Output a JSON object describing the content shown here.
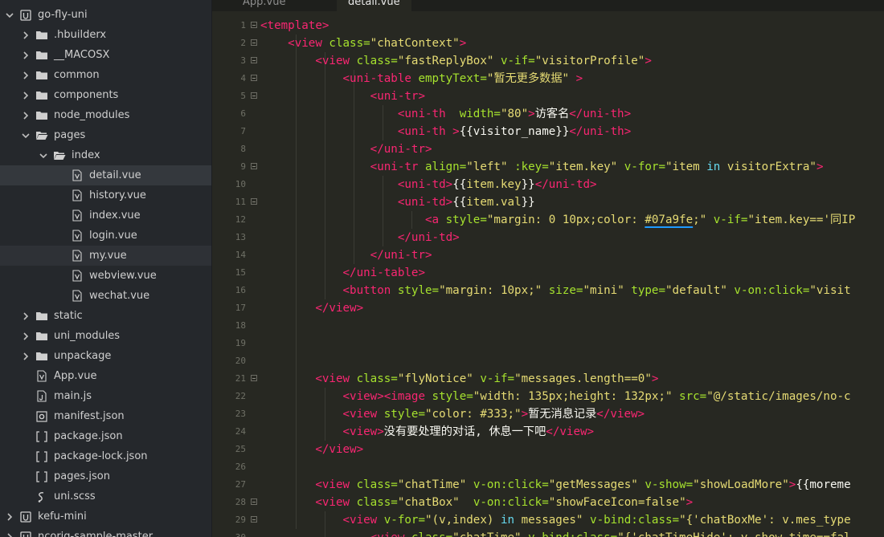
{
  "explorer": {
    "items": [
      {
        "label": "go-fly-uni",
        "depth": 0,
        "kind": "project",
        "expanded": true
      },
      {
        "label": ".hbuilderx",
        "depth": 1,
        "kind": "folder",
        "expanded": false
      },
      {
        "label": "__MACOSX",
        "depth": 1,
        "kind": "folder",
        "expanded": false
      },
      {
        "label": "common",
        "depth": 1,
        "kind": "folder",
        "expanded": false
      },
      {
        "label": "components",
        "depth": 1,
        "kind": "folder",
        "expanded": false
      },
      {
        "label": "node_modules",
        "depth": 1,
        "kind": "folder",
        "expanded": false
      },
      {
        "label": "pages",
        "depth": 1,
        "kind": "folder-open",
        "expanded": true
      },
      {
        "label": "index",
        "depth": 2,
        "kind": "folder-open",
        "expanded": true
      },
      {
        "label": "detail.vue",
        "depth": 3,
        "kind": "vue",
        "selected": true
      },
      {
        "label": "history.vue",
        "depth": 3,
        "kind": "vue"
      },
      {
        "label": "index.vue",
        "depth": 3,
        "kind": "vue"
      },
      {
        "label": "login.vue",
        "depth": 3,
        "kind": "vue"
      },
      {
        "label": "my.vue",
        "depth": 3,
        "kind": "vue",
        "hover": true
      },
      {
        "label": "webview.vue",
        "depth": 3,
        "kind": "vue"
      },
      {
        "label": "wechat.vue",
        "depth": 3,
        "kind": "vue"
      },
      {
        "label": "static",
        "depth": 1,
        "kind": "folder",
        "expanded": false
      },
      {
        "label": "uni_modules",
        "depth": 1,
        "kind": "folder",
        "expanded": false
      },
      {
        "label": "unpackage",
        "depth": 1,
        "kind": "folder",
        "expanded": false
      },
      {
        "label": "App.vue",
        "depth": 1,
        "kind": "vue"
      },
      {
        "label": "main.js",
        "depth": 1,
        "kind": "js"
      },
      {
        "label": "manifest.json",
        "depth": 1,
        "kind": "manifest"
      },
      {
        "label": "package.json",
        "depth": 1,
        "kind": "json"
      },
      {
        "label": "package-lock.json",
        "depth": 1,
        "kind": "json"
      },
      {
        "label": "pages.json",
        "depth": 1,
        "kind": "json"
      },
      {
        "label": "uni.scss",
        "depth": 1,
        "kind": "scss"
      },
      {
        "label": "kefu-mini",
        "depth": 0,
        "kind": "project",
        "expanded": false
      },
      {
        "label": "ncorig-sample-master",
        "depth": 0,
        "kind": "project",
        "expanded": false
      }
    ]
  },
  "tabs": [
    {
      "label": "App.vue",
      "active": false
    },
    {
      "label": "detail.vue",
      "active": true
    }
  ],
  "editor": {
    "lines": [
      {
        "n": "1",
        "fold": true,
        "tokens": [
          [
            "t",
            "<template>"
          ]
        ]
      },
      {
        "n": "2",
        "fold": true,
        "tokens": [
          [
            "p",
            "    "
          ],
          [
            "t",
            "<view "
          ],
          [
            "a",
            "class="
          ],
          [
            "s",
            "\"chatContext\""
          ],
          [
            "t",
            ">"
          ]
        ]
      },
      {
        "n": "3",
        "fold": true,
        "tokens": [
          [
            "p",
            "        "
          ],
          [
            "t",
            "<view "
          ],
          [
            "a",
            "class="
          ],
          [
            "s",
            "\"fastReplyBox\" "
          ],
          [
            "a",
            "v-if="
          ],
          [
            "s",
            "\"visitorProfile\""
          ],
          [
            "t",
            ">"
          ]
        ]
      },
      {
        "n": "4",
        "fold": true,
        "tokens": [
          [
            "p",
            "            "
          ],
          [
            "t",
            "<uni-table "
          ],
          [
            "a",
            "emptyText="
          ],
          [
            "s",
            "\"暂无更多数据\" "
          ],
          [
            "t",
            ">"
          ]
        ]
      },
      {
        "n": "5",
        "fold": true,
        "tokens": [
          [
            "p",
            "                "
          ],
          [
            "t",
            "<uni-tr>"
          ]
        ]
      },
      {
        "n": "6",
        "fold": false,
        "tokens": [
          [
            "p",
            "                    "
          ],
          [
            "t",
            "<uni-th  "
          ],
          [
            "a",
            "width="
          ],
          [
            "s",
            "\"80\""
          ],
          [
            "t",
            ">"
          ],
          [
            "p",
            "访客名"
          ],
          [
            "t",
            "</uni-th>"
          ]
        ]
      },
      {
        "n": "7",
        "fold": false,
        "tokens": [
          [
            "p",
            "                    "
          ],
          [
            "t",
            "<uni-th >"
          ],
          [
            "p",
            "{{visitor_name}}"
          ],
          [
            "t",
            "</uni-th>"
          ]
        ]
      },
      {
        "n": "8",
        "fold": false,
        "tokens": [
          [
            "p",
            "                "
          ],
          [
            "t",
            "</uni-tr>"
          ]
        ]
      },
      {
        "n": "9",
        "fold": true,
        "tokens": [
          [
            "p",
            "                "
          ],
          [
            "t",
            "<uni-tr "
          ],
          [
            "a",
            "align="
          ],
          [
            "s",
            "\"left\" "
          ],
          [
            "a",
            ":key="
          ],
          [
            "s",
            "\"item.key\" "
          ],
          [
            "a",
            "v-for="
          ],
          [
            "s",
            "\"item "
          ],
          [
            "k",
            "in"
          ],
          [
            "s",
            " visitorExtra\""
          ],
          [
            "t",
            ">"
          ]
        ]
      },
      {
        "n": "10",
        "fold": false,
        "tokens": [
          [
            "p",
            "                    "
          ],
          [
            "t",
            "<uni-td>"
          ],
          [
            "p",
            "{{"
          ],
          [
            "s",
            "item.key"
          ],
          [
            "p",
            "}}"
          ],
          [
            "t",
            "</uni-td>"
          ]
        ]
      },
      {
        "n": "11",
        "fold": true,
        "tokens": [
          [
            "p",
            "                    "
          ],
          [
            "t",
            "<uni-td>"
          ],
          [
            "p",
            "{{"
          ],
          [
            "s",
            "item.val"
          ],
          [
            "p",
            "}}"
          ]
        ]
      },
      {
        "n": "12",
        "fold": false,
        "tokens": [
          [
            "p",
            "                        "
          ],
          [
            "t",
            "<a "
          ],
          [
            "a",
            "style="
          ],
          [
            "s",
            "\"margin: 0 10px;color: "
          ],
          [
            "c",
            "#07a9fe"
          ],
          [
            "s",
            ";\" "
          ],
          [
            "a",
            "v-if="
          ],
          [
            "s",
            "\"item.key=='同IP"
          ]
        ]
      },
      {
        "n": "13",
        "fold": false,
        "tokens": [
          [
            "p",
            "                    "
          ],
          [
            "t",
            "</uni-td>"
          ]
        ]
      },
      {
        "n": "14",
        "fold": false,
        "tokens": [
          [
            "p",
            "                "
          ],
          [
            "t",
            "</uni-tr>"
          ]
        ]
      },
      {
        "n": "15",
        "fold": false,
        "tokens": [
          [
            "p",
            "            "
          ],
          [
            "t",
            "</uni-table>"
          ]
        ]
      },
      {
        "n": "16",
        "fold": false,
        "tokens": [
          [
            "p",
            "            "
          ],
          [
            "t",
            "<button "
          ],
          [
            "a",
            "style="
          ],
          [
            "s",
            "\"margin: 10px;\" "
          ],
          [
            "a",
            "size="
          ],
          [
            "s",
            "\"mini\" "
          ],
          [
            "a",
            "type="
          ],
          [
            "s",
            "\"default\" "
          ],
          [
            "a",
            "v-on:click="
          ],
          [
            "s",
            "\"visit"
          ]
        ]
      },
      {
        "n": "17",
        "fold": false,
        "tokens": [
          [
            "p",
            "        "
          ],
          [
            "t",
            "</view>"
          ]
        ]
      },
      {
        "n": "18",
        "fold": false,
        "tokens": []
      },
      {
        "n": "19",
        "fold": false,
        "tokens": []
      },
      {
        "n": "20",
        "fold": false,
        "tokens": []
      },
      {
        "n": "21",
        "fold": true,
        "tokens": [
          [
            "p",
            "        "
          ],
          [
            "t",
            "<view "
          ],
          [
            "a",
            "class="
          ],
          [
            "s",
            "\"flyNotice\" "
          ],
          [
            "a",
            "v-if="
          ],
          [
            "s",
            "\"messages.length==0\""
          ],
          [
            "t",
            ">"
          ]
        ]
      },
      {
        "n": "22",
        "fold": false,
        "tokens": [
          [
            "p",
            "            "
          ],
          [
            "t",
            "<view><image "
          ],
          [
            "a",
            "style="
          ],
          [
            "s",
            "\"width: 135px;height: 132px;\" "
          ],
          [
            "a",
            "src="
          ],
          [
            "s",
            "\"@/static/images/no-c"
          ]
        ]
      },
      {
        "n": "23",
        "fold": false,
        "tokens": [
          [
            "p",
            "            "
          ],
          [
            "t",
            "<view "
          ],
          [
            "a",
            "style="
          ],
          [
            "s",
            "\"color: #333;\""
          ],
          [
            "t",
            ">"
          ],
          [
            "p",
            "暂无消息记录"
          ],
          [
            "t",
            "</view>"
          ]
        ]
      },
      {
        "n": "24",
        "fold": false,
        "tokens": [
          [
            "p",
            "            "
          ],
          [
            "t",
            "<view>"
          ],
          [
            "p",
            "没有要处理的对话, 休息一下吧"
          ],
          [
            "t",
            "</view>"
          ]
        ]
      },
      {
        "n": "25",
        "fold": false,
        "tokens": [
          [
            "p",
            "        "
          ],
          [
            "t",
            "</view>"
          ]
        ]
      },
      {
        "n": "26",
        "fold": false,
        "tokens": []
      },
      {
        "n": "27",
        "fold": false,
        "tokens": [
          [
            "p",
            "        "
          ],
          [
            "t",
            "<view "
          ],
          [
            "a",
            "class="
          ],
          [
            "s",
            "\"chatTime\" "
          ],
          [
            "a",
            "v-on:click="
          ],
          [
            "s",
            "\"getMessages\" "
          ],
          [
            "a",
            "v-show="
          ],
          [
            "s",
            "\"showLoadMore\""
          ],
          [
            "t",
            ">"
          ],
          [
            "p",
            "{{moreme"
          ]
        ]
      },
      {
        "n": "28",
        "fold": true,
        "tokens": [
          [
            "p",
            "        "
          ],
          [
            "t",
            "<view "
          ],
          [
            "a",
            "class="
          ],
          [
            "s",
            "\"chatBox\"  "
          ],
          [
            "a",
            "v-on:click="
          ],
          [
            "s",
            "\"showFaceIcon=false\""
          ],
          [
            "t",
            ">"
          ]
        ]
      },
      {
        "n": "29",
        "fold": true,
        "tokens": [
          [
            "p",
            "            "
          ],
          [
            "t",
            "<view "
          ],
          [
            "a",
            "v-for="
          ],
          [
            "s",
            "\"(v,index) "
          ],
          [
            "k",
            "in"
          ],
          [
            "s",
            " messages\" "
          ],
          [
            "a",
            "v-bind:class="
          ],
          [
            "s",
            "\"{'chatBoxMe': v.mes_type"
          ]
        ]
      },
      {
        "n": "30",
        "fold": false,
        "tokens": [
          [
            "p",
            "                "
          ],
          [
            "t",
            "<view "
          ],
          [
            "a",
            "class="
          ],
          [
            "s",
            "\"chatTime\" "
          ],
          [
            "a",
            "v-bind:class="
          ],
          [
            "s",
            "\"{'chatTimeHide': v.show_time==fal"
          ]
        ]
      }
    ]
  }
}
